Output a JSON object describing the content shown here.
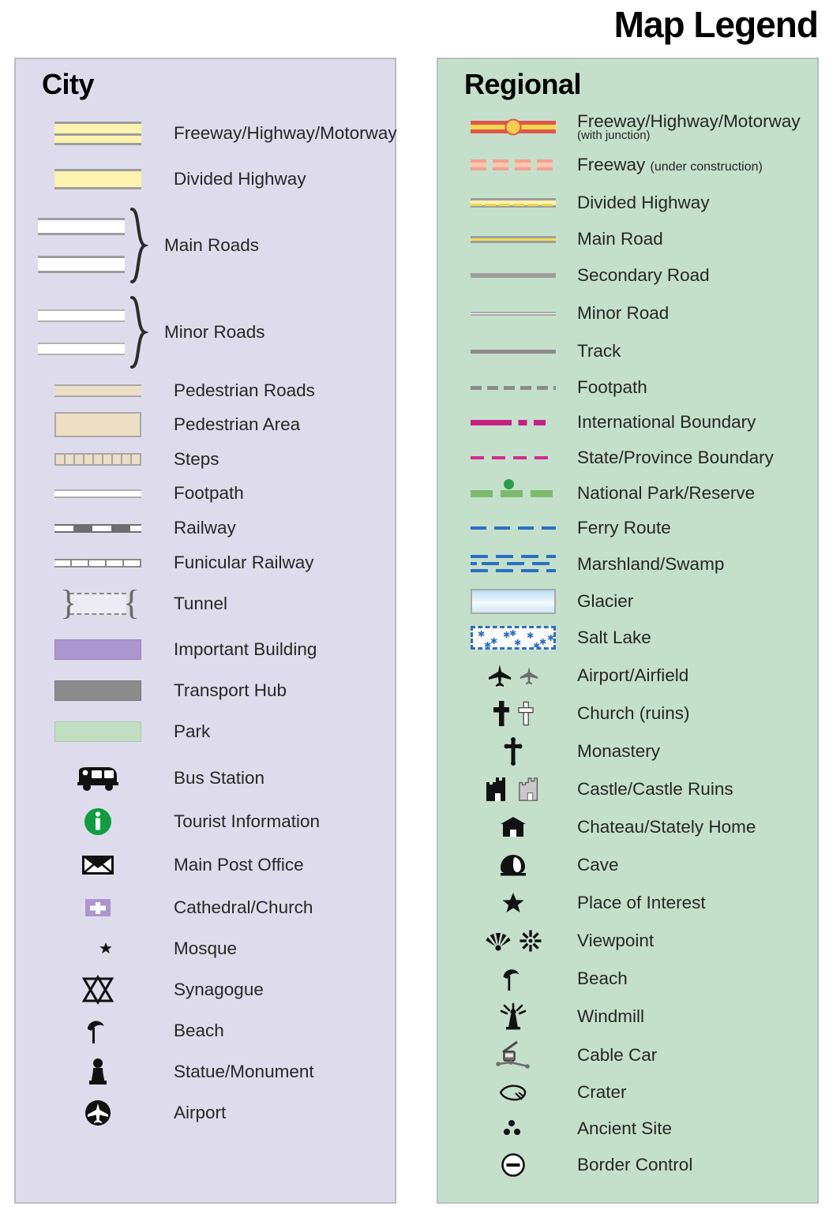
{
  "title": "Map Legend",
  "city": {
    "heading": "City",
    "items": [
      {
        "label": "Freeway/Highway/Motorway",
        "symbol": "freeway-band"
      },
      {
        "label": "Divided Highway",
        "symbol": "divided-highway-band"
      },
      {
        "label": "Main Roads",
        "symbol": "main-roads-bracketed-pair"
      },
      {
        "label": "Minor Roads",
        "symbol": "minor-roads-bracketed-pair"
      },
      {
        "label": "Pedestrian Roads",
        "symbol": "pedestrian-road-band"
      },
      {
        "label": "Pedestrian Area",
        "symbol": "pedestrian-area-block"
      },
      {
        "label": "Steps",
        "symbol": "steps-hatched-band"
      },
      {
        "label": "Footpath",
        "symbol": "footpath-thin-band"
      },
      {
        "label": "Railway",
        "symbol": "railway-dashed-band"
      },
      {
        "label": "Funicular Railway",
        "symbol": "funicular-ticked-band"
      },
      {
        "label": "Tunnel",
        "symbol": "tunnel-brackets"
      },
      {
        "label": "Important Building",
        "symbol": "important-building-swatch"
      },
      {
        "label": "Transport Hub",
        "symbol": "transport-hub-swatch"
      },
      {
        "label": "Park",
        "symbol": "park-swatch"
      },
      {
        "label": "Bus Station",
        "symbol": "bus-icon"
      },
      {
        "label": "Tourist Information",
        "symbol": "information-icon"
      },
      {
        "label": "Main Post Office",
        "symbol": "envelope-icon"
      },
      {
        "label": "Cathedral/Church",
        "symbol": "church-cross-block-icon"
      },
      {
        "label": "Mosque",
        "symbol": "crescent-star-icon"
      },
      {
        "label": "Synagogue",
        "symbol": "star-of-david-icon"
      },
      {
        "label": "Beach",
        "symbol": "parasol-icon"
      },
      {
        "label": "Statue/Monument",
        "symbol": "statue-icon"
      },
      {
        "label": "Airport",
        "symbol": "airplane-circle-icon"
      }
    ]
  },
  "regional": {
    "heading": "Regional",
    "items": [
      {
        "label": "Freeway/Highway/Motorway",
        "sublabel": "(with junction)",
        "symbol": "freeway-junction-line"
      },
      {
        "label": "Freeway",
        "sublabel": "(under construction)",
        "symbol": "freeway-under-construction-line"
      },
      {
        "label": "Divided Highway",
        "symbol": "divided-highway-line"
      },
      {
        "label": "Main Road",
        "symbol": "main-road-line"
      },
      {
        "label": "Secondary Road",
        "symbol": "secondary-road-line"
      },
      {
        "label": "Minor Road",
        "symbol": "minor-road-line"
      },
      {
        "label": "Track",
        "symbol": "track-line"
      },
      {
        "label": "Footpath",
        "symbol": "footpath-dashed-line"
      },
      {
        "label": "International Boundary",
        "symbol": "international-boundary-line"
      },
      {
        "label": "State/Province Boundary",
        "symbol": "state-boundary-line"
      },
      {
        "label": "National Park/Reserve",
        "symbol": "national-park-line"
      },
      {
        "label": "Ferry Route",
        "symbol": "ferry-route-line"
      },
      {
        "label": "Marshland/Swamp",
        "symbol": "marshland-pattern"
      },
      {
        "label": "Glacier",
        "symbol": "glacier-swatch"
      },
      {
        "label": "Salt Lake",
        "symbol": "salt-lake-swatch"
      },
      {
        "label": "Airport/Airfield",
        "symbol": "airplane-pair-icon"
      },
      {
        "label": "Church (ruins)",
        "symbol": "cross-pair-icon"
      },
      {
        "label": "Monastery",
        "symbol": "monastery-cross-icon"
      },
      {
        "label": "Castle/Castle Ruins",
        "symbol": "castle-pair-icon"
      },
      {
        "label": "Chateau/Stately Home",
        "symbol": "chateau-icon"
      },
      {
        "label": "Cave",
        "symbol": "cave-icon"
      },
      {
        "label": "Place of Interest",
        "symbol": "star-icon"
      },
      {
        "label": "Viewpoint",
        "symbol": "viewpoint-pair-icon"
      },
      {
        "label": "Beach",
        "symbol": "parasol-icon"
      },
      {
        "label": "Windmill",
        "symbol": "windmill-icon"
      },
      {
        "label": "Cable Car",
        "symbol": "cable-car-icon"
      },
      {
        "label": "Crater",
        "symbol": "crater-icon"
      },
      {
        "label": "Ancient Site",
        "symbol": "ancient-site-dots-icon"
      },
      {
        "label": "Border Control",
        "symbol": "border-control-icon"
      }
    ]
  },
  "colors": {
    "city_panel_bg": "#dedcec",
    "regional_panel_bg": "#c4e0ca",
    "panel_border": "#b9bcc4",
    "road_yellow": "#fbf3ae",
    "freeway_red": "#e0564a",
    "junction_yellow": "#f5cf4d",
    "pedestrian_tan": "#ecdfc6",
    "important_building_purple": "#ac96ce",
    "transport_hub_grey": "#8c8c8c",
    "park_green": "#c2dfc4",
    "boundary_magenta": "#c81f85",
    "water_blue": "#2b6fc4",
    "park_line_green": "#7cbb6e",
    "info_green": "#0f9d3f",
    "text": "#262626"
  }
}
